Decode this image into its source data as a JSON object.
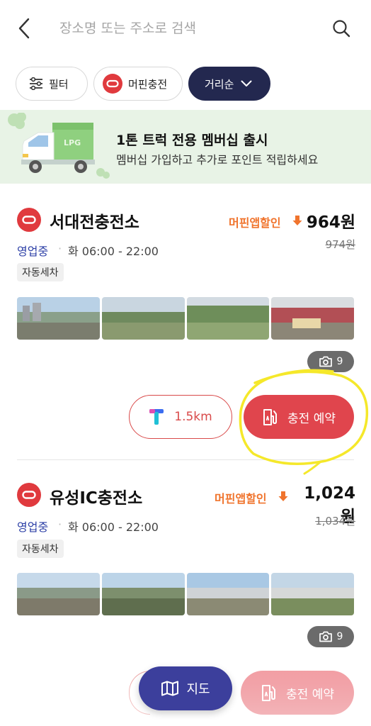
{
  "search": {
    "placeholder": "장소명 또는 주소로 검색"
  },
  "chips": {
    "filter_label": "필터",
    "brand_label": "머핀충전",
    "sort_label": "거리순"
  },
  "banner": {
    "title": "1톤 트럭 전용 멤버십 출시",
    "subtitle": "멤버십 가입하고 추가로 포인트 적립하세요",
    "truck_text": "LPG"
  },
  "stations": [
    {
      "name": "서대전충전소",
      "discount_label": "머핀앱할인",
      "price": "964원",
      "original_price": "974원",
      "status": "영업중",
      "hours": "화 06:00 - 22:00",
      "tag": "자동세차",
      "photo_count": "9",
      "distance": "1.5km",
      "reserve_label": "충전 예약"
    },
    {
      "name": "유성IC충전소",
      "discount_label": "머핀앱할인",
      "price": "1,024원",
      "original_price": "1,034원",
      "status": "영업중",
      "hours": "화 06:00 - 22:00",
      "tag": "자동세차",
      "photo_count": "9",
      "reserve_label": "충전 예약"
    }
  ],
  "floating": {
    "map_label": "지도"
  },
  "colors": {
    "brand_red": "#e0454d",
    "navy": "#23284f",
    "discount_orange": "#f0742d",
    "status_blue": "#2c3fa6",
    "banner_bg": "#e8f3e6",
    "highlight_yellow": "#f5e82a"
  }
}
